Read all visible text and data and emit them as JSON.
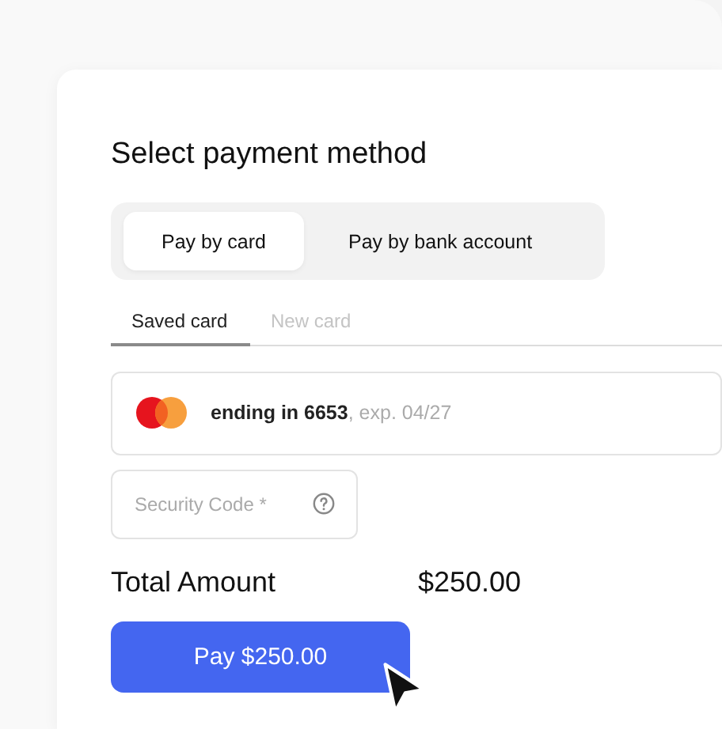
{
  "title": "Select payment method",
  "methods": [
    {
      "label": "Pay by card",
      "selected": true
    },
    {
      "label": "Pay by bank account",
      "selected": false
    }
  ],
  "tabs": [
    {
      "label": "Saved card",
      "selected": true
    },
    {
      "label": "New card",
      "selected": false
    }
  ],
  "saved_card": {
    "label": "ending in 6653",
    "expiry": ", exp. 04/27"
  },
  "security_code": {
    "placeholder": "Security Code *"
  },
  "total": {
    "label": "Total Amount",
    "amount": "$250.00"
  },
  "pay_button": "Pay $250.00"
}
